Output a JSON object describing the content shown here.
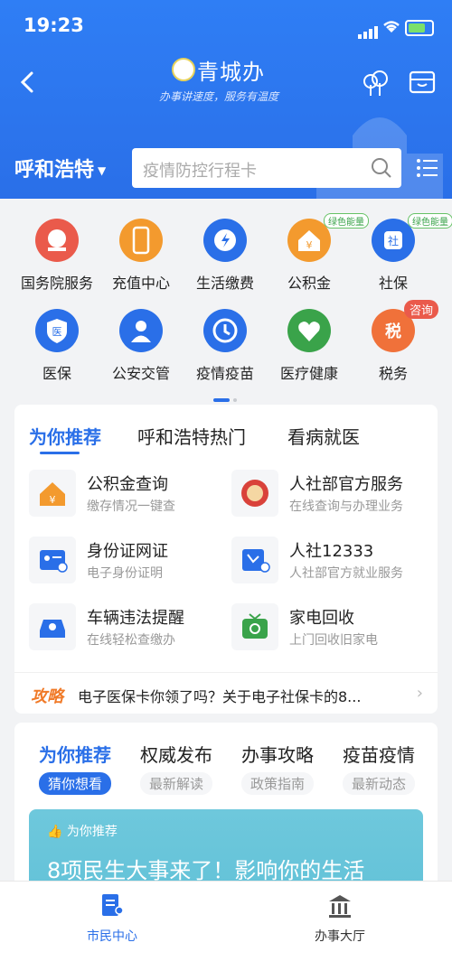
{
  "status_bar": {
    "time": "19:23"
  },
  "header": {
    "logo_name": "青城办",
    "slogan": "办事讲速度，服务有温度",
    "city": "呼和浩特",
    "search_placeholder": "疫情防控行程卡"
  },
  "services": [
    {
      "label": "国务院服务",
      "icon": "state-council-icon",
      "color": "#ea5a4b"
    },
    {
      "label": "充值中心",
      "icon": "phone-icon",
      "color": "#f39a2e"
    },
    {
      "label": "生活缴费",
      "icon": "lightning-icon",
      "color": "#2a6fe8"
    },
    {
      "label": "公积金",
      "icon": "house-yuan-icon",
      "color": "#f39a2e",
      "badge": "绿色能量"
    },
    {
      "label": "社保",
      "icon": "social-security-icon",
      "color": "#2a6fe8",
      "badge": "绿色能量"
    },
    {
      "label": "医保",
      "icon": "medical-insurance-icon",
      "color": "#2a6fe8"
    },
    {
      "label": "公安交管",
      "icon": "police-icon",
      "color": "#2a6fe8"
    },
    {
      "label": "疫情疫苗",
      "icon": "clock-icon",
      "color": "#2a6fe8"
    },
    {
      "label": "医疗健康",
      "icon": "health-icon",
      "color": "#3aa34a"
    },
    {
      "label": "税务",
      "icon": "tax-icon",
      "color": "#f0713a",
      "badge": "咨询"
    }
  ],
  "recommend": {
    "tabs": [
      "为你推荐",
      "呼和浩特热门",
      "看病就医"
    ],
    "items": [
      {
        "title": "公积金查询",
        "subtitle": "缴存情况一键查"
      },
      {
        "title": "人社部官方服务",
        "subtitle": "在线查询与办理业务"
      },
      {
        "title": "身份证网证",
        "subtitle": "电子身份证明"
      },
      {
        "title": "人社12333",
        "subtitle": "人社部官方就业服务"
      },
      {
        "title": "车辆违法提醒",
        "subtitle": "在线轻松查缴办"
      },
      {
        "title": "家电回收",
        "subtitle": "上门回收旧家电"
      }
    ],
    "strategy_badge": "攻略",
    "strategy_text": "电子医保卡你领了吗？关于电子社保卡的8..."
  },
  "feed": {
    "tabs": [
      {
        "title": "为你推荐",
        "sub": "猜你想看"
      },
      {
        "title": "权威发布",
        "sub": "最新解读"
      },
      {
        "title": "办事攻略",
        "sub": "政策指南"
      },
      {
        "title": "疫苗疫情",
        "sub": "最新动态"
      }
    ],
    "banner_tag": "为你推荐",
    "banner_title": "8项民生大事来了！影响你的生活"
  },
  "tabbar": {
    "left": "市民中心",
    "right": "办事大厅"
  },
  "colors": {
    "primary": "#2a6fe8",
    "accent": "#f07a28"
  }
}
